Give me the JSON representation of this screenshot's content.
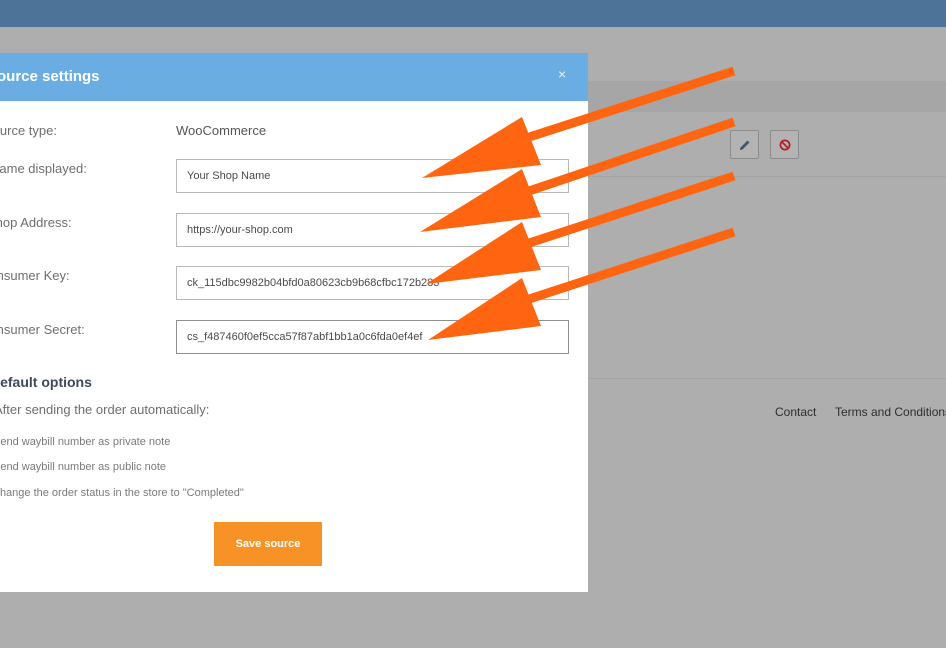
{
  "modal": {
    "title": "Source settings",
    "close_glyph": "×",
    "fields": [
      {
        "label": "Source type:",
        "value": "WooCommerce"
      },
      {
        "label": "Name displayed:",
        "value": "Your Shop Name"
      },
      {
        "label": "Shop Address:",
        "value": "https://your-shop.com"
      },
      {
        "label": "Consumer Key:",
        "value": "ck_115dbc9982b04bfd0a80623cb9b68cfbc172b283"
      },
      {
        "label": "Consumer Secret:",
        "value": "cs_f487460f0ef5cca57f87abf1bb1a0c6fda0ef4ef"
      }
    ],
    "default_options": {
      "title": "Default options",
      "subtitle": "After sending the order automatically:",
      "items": [
        "Send waybill number as private note",
        "Send waybill number as public note",
        "Change the order status in the store to \"Completed\""
      ]
    },
    "save_label": "Save source"
  },
  "background": {
    "edit_icon": "pencil-icon",
    "block_icon": "block-icon",
    "footer_links": [
      "Contact",
      "Terms and Conditions"
    ]
  },
  "annotation": {
    "arrow_color": "#ff6410",
    "arrow_count": 4
  },
  "colors": {
    "header_bar": "#4d7498",
    "modal_header": "#6aade3",
    "save_button": "#f79227"
  }
}
